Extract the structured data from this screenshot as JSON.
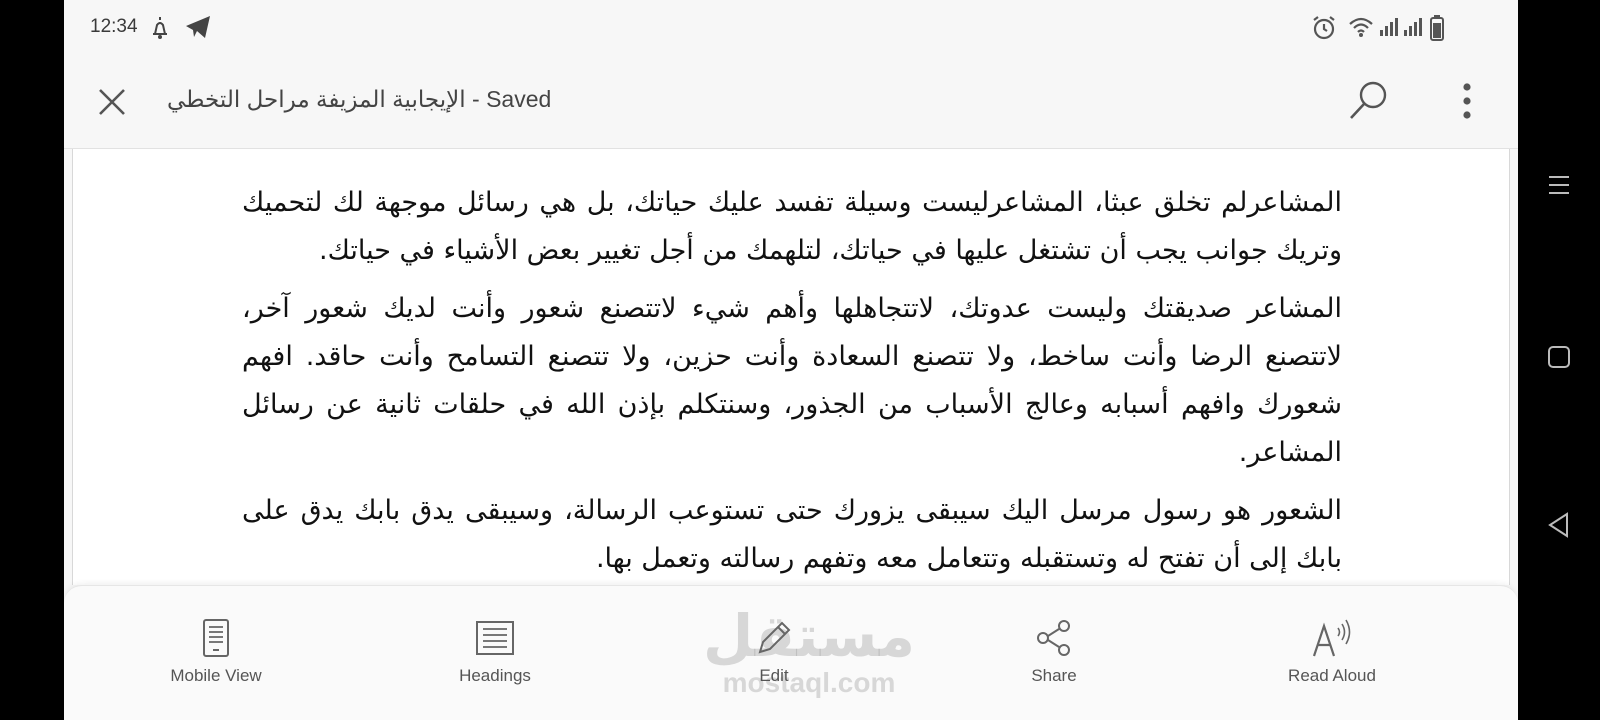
{
  "status_bar": {
    "time": "12:34",
    "left_icons": [
      "notification-icon",
      "telegram-icon"
    ],
    "right_icons": [
      "alarm-icon",
      "wifi-icon",
      "signal-icon",
      "signal-icon",
      "battery-icon"
    ]
  },
  "app_bar": {
    "title": "الإيجابية المزيفة مراحل التخطي - Saved",
    "close_icon": "close-icon",
    "search_icon": "search-icon",
    "more_icon": "more-vertical-icon"
  },
  "document": {
    "paragraphs": [
      "المشاعرلم تخلق عبثا، المشاعرليست وسيلة تفسد عليك حياتك، بل هي رسائل موجهة لك لتحميك وتريك جوانب يجب أن تشتغل عليها في حياتك، لتلهمك من أجل تغيير بعض الأشياء في حياتك.",
      "المشاعر صديقتك وليست عدوتك، لاتتجاهلها وأهم شيء لاتتصنع شعور وأنت لديك شعور آخر، لاتتصنع الرضا وأنت ساخط، ولا تتصنع السعادة وأنت حزين، ولا تتصنع التسامح وأنت حاقد. افهم شعورك وافهم أسبابه وعالج الأسباب من الجذور، وسنتكلم بإذن الله في حلقات ثانية عن رسائل المشاعر.",
      "الشعور هو رسول مرسل اليك سيبقى يزورك حتى تستوعب الرسالة، وسيبقى يدق بابك يدق على بابك إلى أن تفتح له وتستقبله وتتعامل معه وتفهم رسالته وتعمل بها."
    ]
  },
  "toolbar": {
    "items": [
      {
        "label": "Mobile View",
        "icon": "mobile-view-icon"
      },
      {
        "label": "Headings",
        "icon": "headings-icon"
      },
      {
        "label": "Edit",
        "icon": "edit-pencil-icon"
      },
      {
        "label": "Share",
        "icon": "share-icon"
      },
      {
        "label": "Read Aloud",
        "icon": "read-aloud-icon"
      }
    ]
  },
  "watermark": {
    "arabic": "مستقل",
    "latin": "mostaql.com"
  },
  "nav_bar": {
    "icons": [
      "recent-apps-icon",
      "home-icon",
      "back-icon"
    ]
  }
}
